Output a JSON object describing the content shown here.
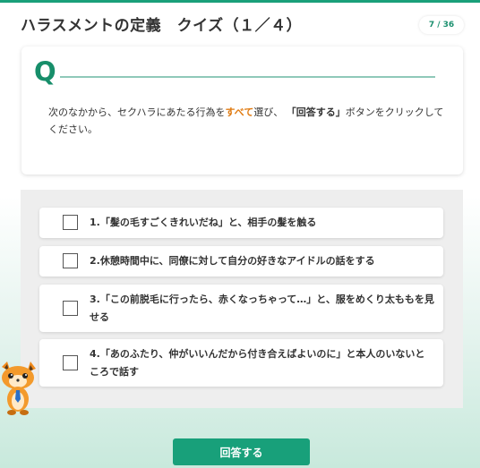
{
  "header": {
    "title": "ハラスメントの定義　クイズ（１／４）",
    "progress": "7 / 36"
  },
  "question": {
    "marker": "Q",
    "text_part1": "次のなかから、セクハラにあたる行為を",
    "text_emphasis": "すべて",
    "text_part2": "選び、",
    "text_button_ref": "「回答する」",
    "text_part3": "ボタンをクリックしてください。"
  },
  "choices": [
    {
      "label": "1.「髪の毛すごくきれいだね」と、相手の髪を触る",
      "checked": false
    },
    {
      "label": "2.休憩時間中に、同僚に対して自分の好きなアイドルの話をする",
      "checked": false
    },
    {
      "label": "3.「この前脱毛に行ったら、赤くなっちゃって…」と、服をめくり太ももを見せる",
      "checked": false
    },
    {
      "label": "4.「あのふたり、仲がいいんだから付き合えばよいのに」と本人のいないところで話す",
      "checked": false
    }
  ],
  "actions": {
    "submit_label": "回答する"
  },
  "colors": {
    "accent": "#18a07a",
    "emphasis": "#e07a10"
  },
  "icons": {
    "mascot": "fox-mascot-icon"
  }
}
